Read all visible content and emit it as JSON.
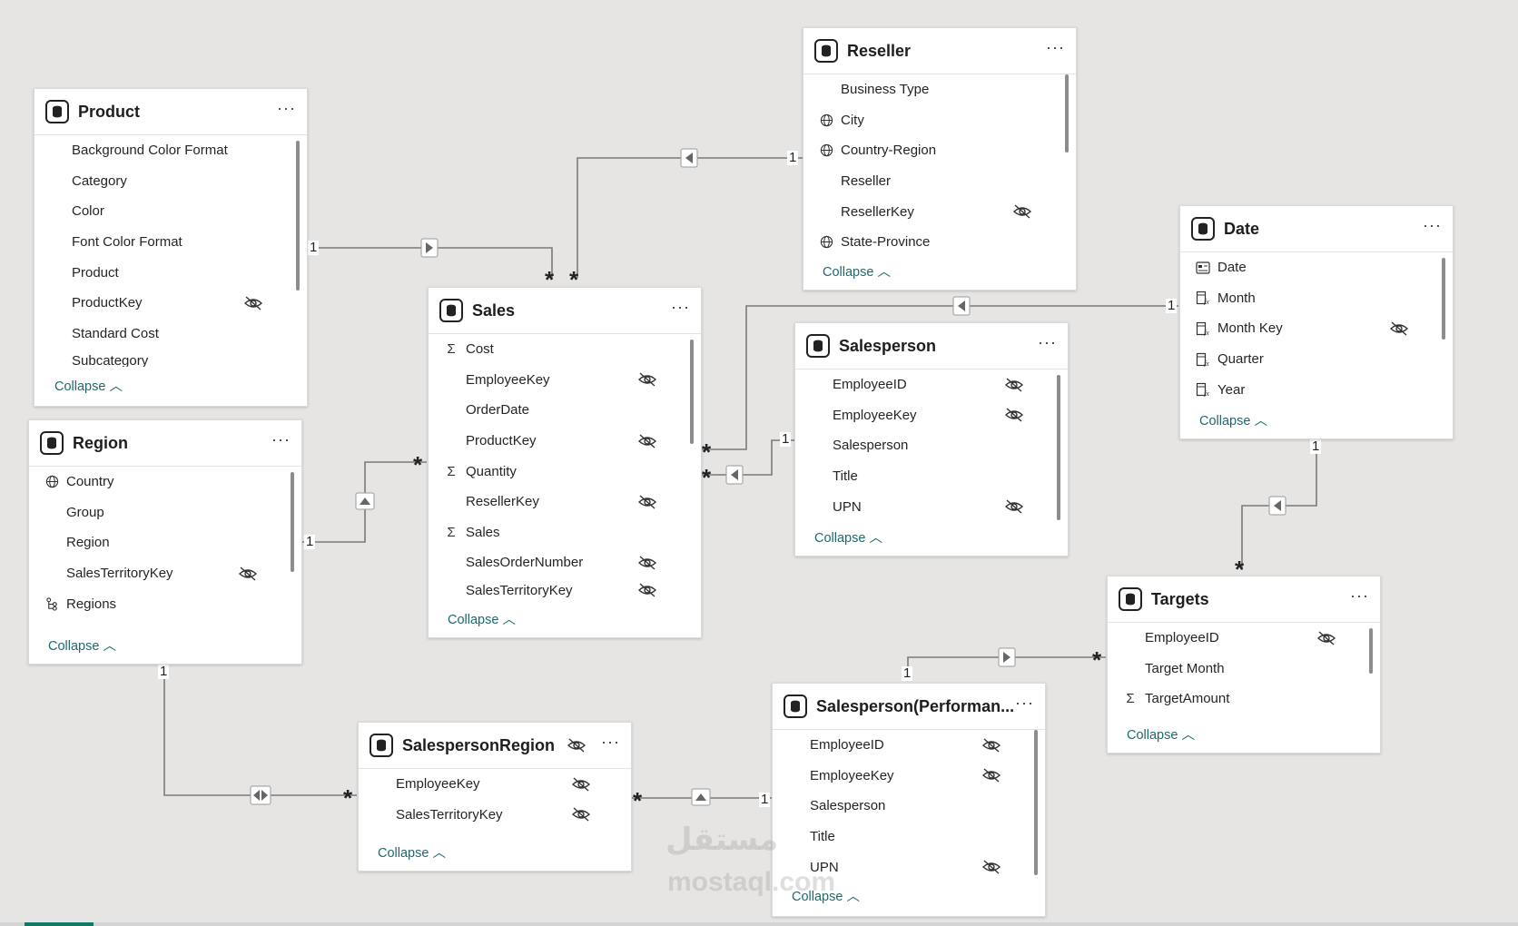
{
  "tables": {
    "product": {
      "title": "Product",
      "fields": [
        "Background Color Format",
        "Category",
        "Color",
        "Font Color Format",
        "Product",
        "ProductKey",
        "Standard Cost",
        "Subcategory"
      ],
      "collapse": "Collapse"
    },
    "region": {
      "title": "Region",
      "fields": [
        "Country",
        "Group",
        "Region",
        "SalesTerritoryKey",
        "Regions"
      ],
      "collapse": "Collapse"
    },
    "sales": {
      "title": "Sales",
      "fields": [
        "Cost",
        "EmployeeKey",
        "OrderDate",
        "ProductKey",
        "Quantity",
        "ResellerKey",
        "Sales",
        "SalesOrderNumber",
        "SalesTerritoryKey"
      ],
      "collapse": "Collapse"
    },
    "reseller": {
      "title": "Reseller",
      "fields": [
        "Business Type",
        "City",
        "Country-Region",
        "Reseller",
        "ResellerKey",
        "State-Province"
      ],
      "collapse": "Collapse"
    },
    "salesperson": {
      "title": "Salesperson",
      "fields": [
        "EmployeeID",
        "EmployeeKey",
        "Salesperson",
        "Title",
        "UPN"
      ],
      "collapse": "Collapse"
    },
    "date": {
      "title": "Date",
      "fields": [
        "Date",
        "Month",
        "Month Key",
        "Quarter",
        "Year"
      ],
      "collapse": "Collapse"
    },
    "targets": {
      "title": "Targets",
      "fields": [
        "EmployeeID",
        "Target Month",
        "TargetAmount"
      ],
      "collapse": "Collapse"
    },
    "salespersonRegion": {
      "title": "SalespersonRegion",
      "fields": [
        "EmployeeKey",
        "SalesTerritoryKey"
      ],
      "collapse": "Collapse"
    },
    "salespersonPerf": {
      "title": "Salesperson(Performan...",
      "fields": [
        "EmployeeID",
        "EmployeeKey",
        "Salesperson",
        "Title",
        "UPN"
      ],
      "collapse": "Collapse"
    }
  },
  "cardinality": {
    "one": "1",
    "many": "*"
  },
  "more_label": "···",
  "watermark": {
    "arabic": "مستقل",
    "latin": "mostaql.com"
  },
  "colors": {
    "canvas": "#e6e5e4",
    "link": "#1f6a70",
    "line": "#7a7a7a",
    "accent": "#117865"
  },
  "icons": {
    "table": "table-icon",
    "sum": "sigma-icon",
    "geo": "globe-icon",
    "hidden": "eye-hidden-icon",
    "date": "calendar-icon",
    "hierarchy": "hierarchy-icon",
    "calc": "calculated-column-icon"
  }
}
